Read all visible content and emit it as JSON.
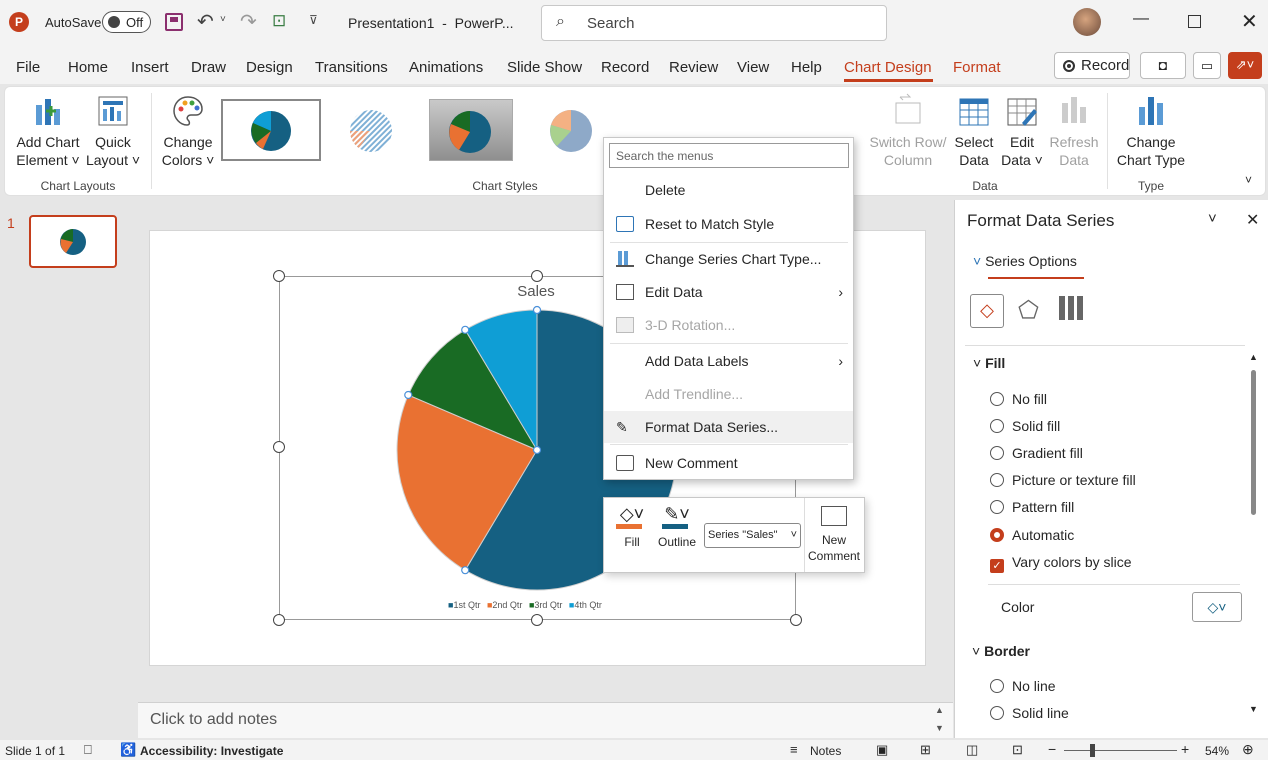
{
  "app": {
    "autosave_label": "AutoSave",
    "autosave_state": "Off",
    "doc_title": "Presentation1  -  PowerP...",
    "search_placeholder": "Search",
    "accent": "#c43e1c"
  },
  "tabs": [
    "File",
    "Home",
    "Insert",
    "Draw",
    "Design",
    "Transitions",
    "Animations",
    "Slide Show",
    "Record",
    "Review",
    "View",
    "Help",
    "Chart Design",
    "Format"
  ],
  "record_button": "Record",
  "ribbon": {
    "add_chart_element": [
      "Add Chart",
      "Element ˅"
    ],
    "quick_layout": [
      "Quick",
      "Layout ˅"
    ],
    "change_colors": [
      "Change",
      "Colors ˅"
    ],
    "switch_row_col": [
      "Switch Row/",
      "Column"
    ],
    "select_data": [
      "Select",
      "Data"
    ],
    "edit_data": [
      "Edit",
      "Data ˅"
    ],
    "refresh_data": [
      "Refresh",
      "Data"
    ],
    "change_chart_type": [
      "Change",
      "Chart Type"
    ],
    "groups": {
      "chart_layouts": "Chart Layouts",
      "chart_styles": "Chart Styles",
      "data": "Data",
      "type": "Type"
    }
  },
  "slide_number": "1",
  "chart": {
    "title": "Sales",
    "legend": [
      "1st Qtr",
      "2nd Qtr",
      "3rd Qtr",
      "4th Qtr"
    ]
  },
  "chart_data": {
    "type": "pie",
    "title": "Sales",
    "categories": [
      "1st Qtr",
      "2nd Qtr",
      "3rd Qtr",
      "4th Qtr"
    ],
    "values": [
      8.2,
      3.2,
      1.4,
      1.2
    ],
    "colors": [
      "#156082",
      "#e97132",
      "#196b24",
      "#0f9ed5"
    ],
    "legend_position": "bottom"
  },
  "context_menu": {
    "search_placeholder": "Search the menus",
    "items": {
      "delete": "Delete",
      "reset": "Reset to Match Style",
      "change_type": "Change Series Chart Type...",
      "edit_data": "Edit Data",
      "rotation": "3-D Rotation...",
      "add_labels": "Add Data Labels",
      "add_trendline": "Add Trendline...",
      "format_series": "Format Data Series...",
      "new_comment": "New Comment"
    }
  },
  "mini_toolbar": {
    "fill": "Fill",
    "outline": "Outline",
    "series_select": "Series \"Sales\"",
    "new_comment": [
      "New",
      "Comment"
    ]
  },
  "notes_placeholder": "Click to add notes",
  "panel": {
    "title": "Format Data Series",
    "series_options": "Series Options",
    "fill_header": "Fill",
    "fill_options": [
      "No fill",
      "Solid fill",
      "Gradient fill",
      "Picture or texture fill",
      "Pattern fill",
      "Automatic"
    ],
    "selected_fill": "Automatic",
    "vary_colors": "Vary colors by slice",
    "color_label": "Color",
    "border_header": "Border",
    "border_options": [
      "No line",
      "Solid line"
    ]
  },
  "status": {
    "slide_info": "Slide 1 of 1",
    "accessibility": "Accessibility: Investigate",
    "notes": "Notes",
    "zoom": "54%"
  }
}
